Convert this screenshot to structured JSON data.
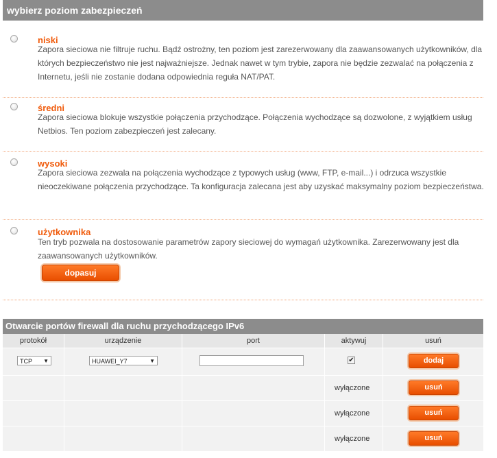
{
  "security": {
    "header": "wybierz poziom zabezpieczeń",
    "options": [
      {
        "title": "niski",
        "desc": "Zapora sieciowa nie filtruje ruchu. Bądź ostrożny, ten poziom jest zarezerwowany dla zaawansowanych użytkowników, dla których bezpieczeństwo nie jest najważniejsze. Jednak nawet w tym trybie, zapora nie będzie zezwalać na połączenia z Internetu, jeśli nie zostanie dodana odpowiednia reguła NAT/PAT."
      },
      {
        "title": "średni",
        "desc": "Zapora sieciowa blokuje wszystkie połączenia przychodzące. Połączenia wychodzące są dozwolone, z wyjątkiem usług Netbios. Ten poziom zabezpieczeń jest zalecany."
      },
      {
        "title": "wysoki",
        "desc": "Zapora sieciowa zezwala na połączenia wychodzące z typowych usług (www, FTP, e-mail...) i odrzuca wszystkie nieoczekiwane połączenia przychodzące. Ta konfiguracja zalecana jest aby uzyskać maksymalny poziom bezpieczeństwa."
      },
      {
        "title": "użytkownika",
        "desc": "Ten tryb pozwala na dostosowanie parametrów zapory sieciowej do wymagań użytkownika. Zarezerwowany jest dla zaawansowanych użytkowników."
      }
    ],
    "customize_label": "dopasuj"
  },
  "ports": {
    "header": "Otwarcie portów firewall dla ruchu przychodzącego IPv6",
    "columns": [
      "protokół",
      "urządzenie",
      "port",
      "aktywuj",
      "usuń"
    ],
    "new_row": {
      "protocol": "TCP",
      "device": "HUAWEI_Y7",
      "port": "",
      "active_mark": "✔",
      "add_label": "dodaj"
    },
    "rows": [
      {
        "status": "wyłączone",
        "delete_label": "usuń"
      },
      {
        "status": "wyłączone",
        "delete_label": "usuń"
      },
      {
        "status": "wyłączone",
        "delete_label": "usuń"
      }
    ]
  },
  "colors": {
    "accent": "#f05a0a",
    "header_bg": "#8c8c8c"
  }
}
